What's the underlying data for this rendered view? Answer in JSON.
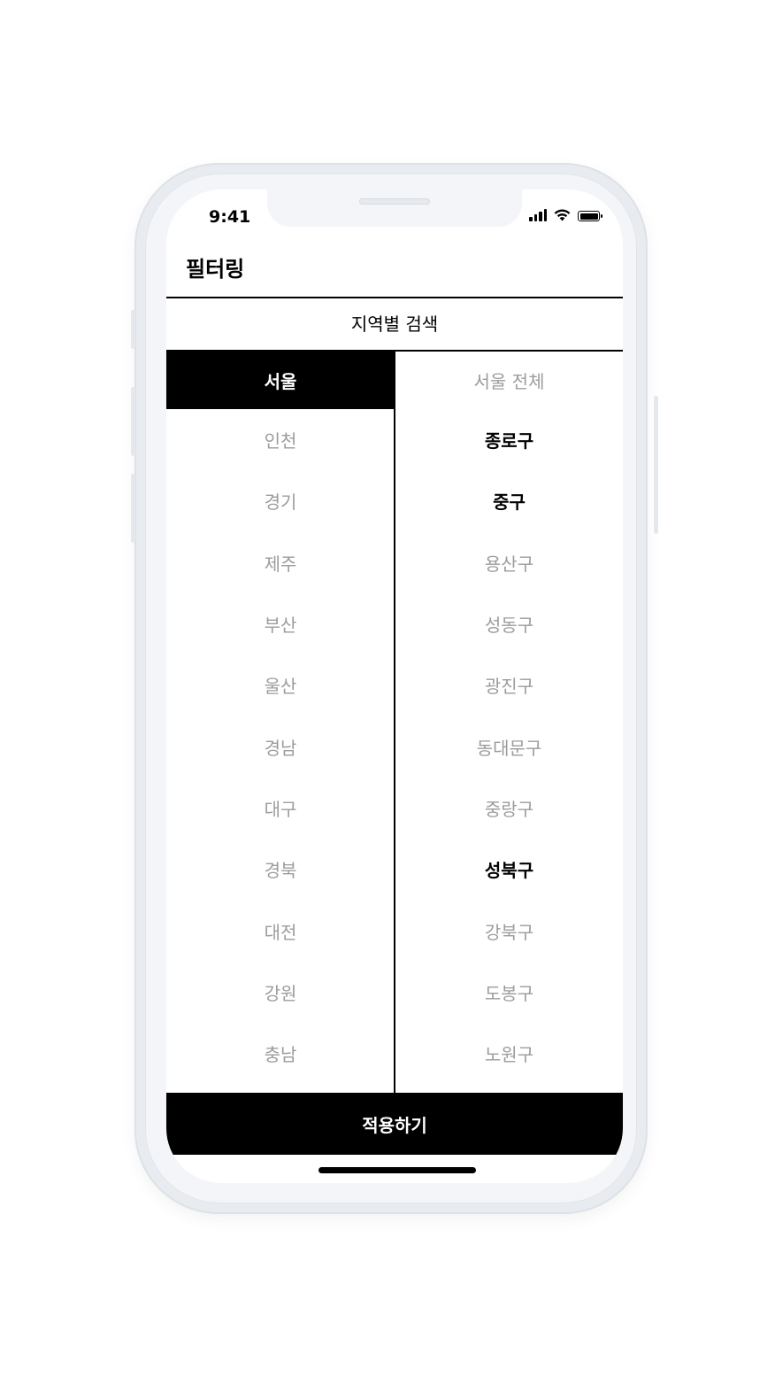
{
  "status_bar": {
    "time": "9:41",
    "signal_icon": "cellular-signal-icon",
    "wifi_icon": "wifi-icon",
    "battery_icon": "battery-icon"
  },
  "header": {
    "title": "필터링"
  },
  "section": {
    "title": "지역별 검색"
  },
  "regions": [
    {
      "label": "서울",
      "selected": true
    },
    {
      "label": "인천",
      "selected": false
    },
    {
      "label": "경기",
      "selected": false
    },
    {
      "label": "제주",
      "selected": false
    },
    {
      "label": "부산",
      "selected": false
    },
    {
      "label": "울산",
      "selected": false
    },
    {
      "label": "경남",
      "selected": false
    },
    {
      "label": "대구",
      "selected": false
    },
    {
      "label": "경북",
      "selected": false
    },
    {
      "label": "대전",
      "selected": false
    },
    {
      "label": "강원",
      "selected": false
    },
    {
      "label": "충남",
      "selected": false
    }
  ],
  "districts": [
    {
      "label": "서울 전체",
      "selected": false
    },
    {
      "label": "종로구",
      "selected": true
    },
    {
      "label": "중구",
      "selected": true
    },
    {
      "label": "용산구",
      "selected": false
    },
    {
      "label": "성동구",
      "selected": false
    },
    {
      "label": "광진구",
      "selected": false
    },
    {
      "label": "동대문구",
      "selected": false
    },
    {
      "label": "중랑구",
      "selected": false
    },
    {
      "label": "성북구",
      "selected": true
    },
    {
      "label": "강북구",
      "selected": false
    },
    {
      "label": "도봉구",
      "selected": false
    },
    {
      "label": "노원구",
      "selected": false
    }
  ],
  "footer": {
    "apply_label": "적용하기"
  },
  "colors": {
    "selected_bg": "#000000",
    "unselected_text": "#9c9c9c",
    "selected_text": "#000000"
  }
}
